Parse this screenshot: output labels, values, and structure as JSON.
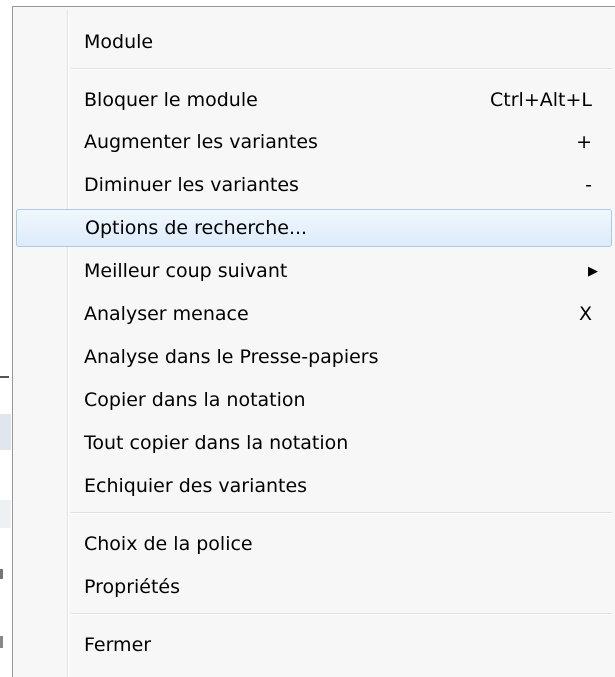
{
  "menu": {
    "header": "Module",
    "items": [
      {
        "label": "Bloquer le module",
        "shortcut": "Ctrl+Alt+L"
      },
      {
        "label": "Augmenter les variantes",
        "shortcut": "+"
      },
      {
        "label": "Diminuer les variantes",
        "shortcut": "-"
      },
      {
        "label": "Options de recherche...",
        "shortcut": ""
      },
      {
        "label": "Meilleur coup suivant",
        "submenu_icon": "submenu-arrow-icon",
        "arrow": "▶"
      },
      {
        "label": "Analyser menace",
        "shortcut": "X"
      },
      {
        "label": "Analyse dans le Presse-papiers",
        "shortcut": ""
      },
      {
        "label": "Copier dans la notation",
        "shortcut": ""
      },
      {
        "label": "Tout copier dans la notation",
        "shortcut": ""
      },
      {
        "label": "Echiquier des variantes",
        "shortcut": ""
      }
    ],
    "group2": [
      {
        "label": "Choix de la police"
      },
      {
        "label": "Propriétés"
      }
    ],
    "group3": [
      {
        "label": "Fermer"
      }
    ],
    "highlight_color": "#dcebfb",
    "highlight_border": "#a9cbe8"
  }
}
